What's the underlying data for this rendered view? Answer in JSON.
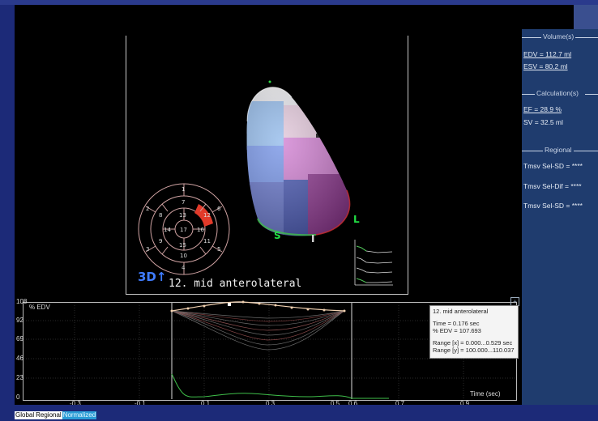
{
  "viewer": {
    "view_label": "3D↑",
    "segment_caption": "12. mid anterolateral",
    "orientation": {
      "septal": "S",
      "inferior": "I",
      "lateral": "L"
    },
    "bullseye_numbers": [
      "1",
      "2",
      "3",
      "4",
      "5",
      "6",
      "7",
      "8",
      "9",
      "10",
      "11",
      "12",
      "13",
      "14",
      "15",
      "16",
      "17"
    ],
    "highlight_segment": "12",
    "highlight_color": "#e23a2a"
  },
  "side_panel": {
    "volumes": {
      "heading": "Volume(s)",
      "edv": "EDV = 112.7 ml",
      "esv": "ESV = 80.2 ml"
    },
    "calculations": {
      "heading": "Calculation(s)",
      "ef": "EF = 28.9 %",
      "sv": "SV = 32.5 ml"
    },
    "regional": {
      "heading": "Regional",
      "items": [
        "Tmsv Sel-SD = ****",
        "Tmsv Sel-Dif = ****",
        "Tmsv Sel-SD = ****"
      ]
    }
  },
  "graph": {
    "y_axis_label": "% EDV",
    "x_axis_label": "Time (sec)",
    "y_ticks": [
      "108",
      "92",
      "69",
      "46",
      "23",
      "0"
    ],
    "x_ticks": [
      "-0.3",
      "-0.1",
      "0.1",
      "0.3",
      "0.5",
      "0.6",
      "0.7",
      "0.9"
    ],
    "tooltip": {
      "title": "12. mid anterolateral",
      "time": "Time = 0.176 sec",
      "edv": "% EDV = 107.693",
      "range_x": "Range [x] = 0.000...0.529 sec",
      "range_y": "Range [y] = 100.000...110.037"
    }
  },
  "tabs": [
    {
      "label": "Global",
      "active": false
    },
    {
      "label": "Regional",
      "active": false
    },
    {
      "label": "Normalized",
      "active": true
    }
  ]
}
